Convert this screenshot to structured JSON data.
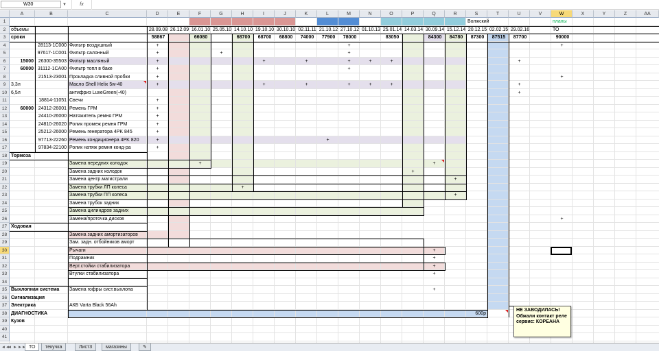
{
  "formula_bar": {
    "cell_ref": "W30",
    "fx_label": "fx",
    "formula": ""
  },
  "columns": [
    "A",
    "B",
    "C",
    "D",
    "E",
    "F",
    "G",
    "H",
    "I",
    "J",
    "K",
    "L",
    "M",
    "N",
    "O",
    "P",
    "Q",
    "R",
    "S",
    "T",
    "U",
    "V",
    "W",
    "X",
    "Y",
    "Z",
    "AA"
  ],
  "selected_column": "W",
  "rows": [
    "1",
    "2",
    "3",
    "4",
    "5",
    "6",
    "7",
    "8",
    "9",
    "10",
    "11",
    "12",
    "13",
    "14",
    "15",
    "16",
    "17",
    "18",
    "19",
    "20",
    "21",
    "22",
    "23",
    "24",
    "25",
    "26",
    "27",
    "28",
    "29",
    "30",
    "31",
    "32",
    "33",
    "34",
    "35",
    "36",
    "37",
    "38",
    "39",
    "40",
    "41"
  ],
  "selected_row": "30",
  "colors": {
    "pink": "#f2dcdb",
    "green": "#ebf1de",
    "blue": "#c5d9f1",
    "lavender": "#e4dfec",
    "pinkhdr": "#da9694",
    "bluehdr": "#538dd5",
    "tealhdr": "#92cddc",
    "yellowsel": "#f7d978",
    "comment_bg": "#ffffe1",
    "green_text": "#00b050"
  },
  "cells": {
    "s1": "Волжский",
    "w1": "планы",
    "a2": "объемы",
    "d2": "28.09.08",
    "e2": "26.12.09",
    "f2": "16.01.10",
    "g2": "25.05.10",
    "h2": "14.10.10",
    "i2": "19.10.10",
    "j2": "30.10.10",
    "k2": "02.11.11",
    "l2": "21.10.12",
    "m2": "27.10.12",
    "n2": "01.10.13",
    "o2": "25.01.14",
    "p2": "14.03.14",
    "q2": "30.09.14",
    "r2": "15.12.14",
    "s2": "20.12.15",
    "t2": "02.02.15",
    "u2": "29.02.16",
    "w2": "ТО",
    "a3": "сроки",
    "d3": "58867",
    "f3": "66080",
    "h3": "68700",
    "i3": "68700",
    "j3": "68800",
    "k3": "74000",
    "l3": "77900",
    "m3": "78000",
    "o3": "83050",
    "q3": "84300",
    "r3": "84780",
    "s3": "87300",
    "t3": "87515",
    "u3": "87700",
    "w3": "90000",
    "b4": "28113-1C000",
    "c4": "Фильтр воздушный",
    "b5": "97617-1C001",
    "c5": "Фильтр салонный",
    "a6": "15000",
    "b6": "26300-35503",
    "c6": "Фильтр масляный",
    "a7": "60000",
    "b7": "31112-1CA00",
    "c7": "Фильтр топл в баке",
    "b8": "21513-23001",
    "c8": "Прокладка сливной пробки",
    "a9": "3,3л",
    "c9": "Масло Shell Helix 5w-40",
    "a10": "6,5л",
    "c10": "антифриз LuxeGreen(-40)",
    "b11": "18814-11051",
    "c11": "Свечи",
    "a12": "60000",
    "b12": "24312-26001",
    "c12": "Ремень ГРМ",
    "b13": "24410-26000",
    "c13": "Натяжитель ремня ГРМ",
    "b14": "24810-26020",
    "c14": "Ролик промеж ремня ГРМ",
    "b15": "25212-26000",
    "c15": "Ремень генератора 4PK 845",
    "b16": "97713-22260",
    "c16": "Ремень кондиционера 4PK 820",
    "b17": "97834-22100",
    "c17": "Ролик натяж ремня конд-ра",
    "a18": "Тормоза",
    "c19": "Замена передних колодок",
    "c20": "Замена задних колодок",
    "c21": "Замена центр.магистрали",
    "c22": "Замена трубки ЛП колеса",
    "c23": "Замена трубки ПП колеса",
    "c24": "Замена трубок задних",
    "c25": "Замена цилиндров задних",
    "c26": "Замена/проточка дисков",
    "a27": "Ходовая",
    "c28": "Замена задних амортизаторов",
    "c29": "Зам. задн. отбойников аморт",
    "c30": "Рычаги",
    "c31": "Подрамник",
    "c32": "Верт.стойки стабилизатора",
    "c33": "Втулки стабилизатора",
    "a35": "Выхлопная система",
    "c35": "Замена гофры сист.выхлопа",
    "a36": "Сигнализация",
    "a37": "Электрика",
    "c37": "АКБ Varta Black 56Ah",
    "a38": "ДИАГНОСТИКА",
    "s38": "600р",
    "a39": "Кузов"
  },
  "plus": "+",
  "plus_marks": [
    [
      "d",
      4
    ],
    [
      "m",
      4
    ],
    [
      "w",
      4
    ],
    [
      "d",
      5
    ],
    [
      "g",
      5
    ],
    [
      "m",
      5
    ],
    [
      "d",
      6
    ],
    [
      "i",
      6
    ],
    [
      "k",
      6
    ],
    [
      "m",
      6
    ],
    [
      "n",
      6
    ],
    [
      "o",
      6
    ],
    [
      "u",
      6
    ],
    [
      "d",
      7
    ],
    [
      "m",
      7
    ],
    [
      "d",
      8
    ],
    [
      "w",
      8
    ],
    [
      "d",
      9
    ],
    [
      "i",
      9
    ],
    [
      "k",
      9
    ],
    [
      "m",
      9
    ],
    [
      "n",
      9
    ],
    [
      "o",
      9
    ],
    [
      "u",
      9
    ],
    [
      "u",
      10
    ],
    [
      "d",
      11
    ],
    [
      "d",
      12
    ],
    [
      "d",
      13
    ],
    [
      "d",
      14
    ],
    [
      "d",
      15
    ],
    [
      "d",
      16
    ],
    [
      "l",
      16
    ],
    [
      "d",
      17
    ],
    [
      "f",
      19
    ],
    [
      "q",
      19
    ],
    [
      "p",
      20
    ],
    [
      "r",
      21
    ],
    [
      "h",
      22
    ],
    [
      "r",
      23
    ],
    [
      "w",
      26
    ],
    [
      "q",
      30
    ],
    [
      "q",
      31
    ],
    [
      "q",
      32
    ],
    [
      "q",
      33
    ],
    [
      "q",
      35
    ]
  ],
  "comment": {
    "line1": "НЕ ЗАВОДИЛАСЬ!",
    "line2": "Обжали контакт реле",
    "line3": "сервис: КОРЕАНА"
  },
  "tabs": [
    {
      "label": "ТО",
      "active": true
    },
    {
      "label": "текучка"
    },
    {
      "label": "Лист3"
    },
    {
      "label": "магазины"
    }
  ],
  "nav": {
    "first": "◄◄",
    "prev": "◄",
    "next": "►",
    "last": "►►"
  }
}
